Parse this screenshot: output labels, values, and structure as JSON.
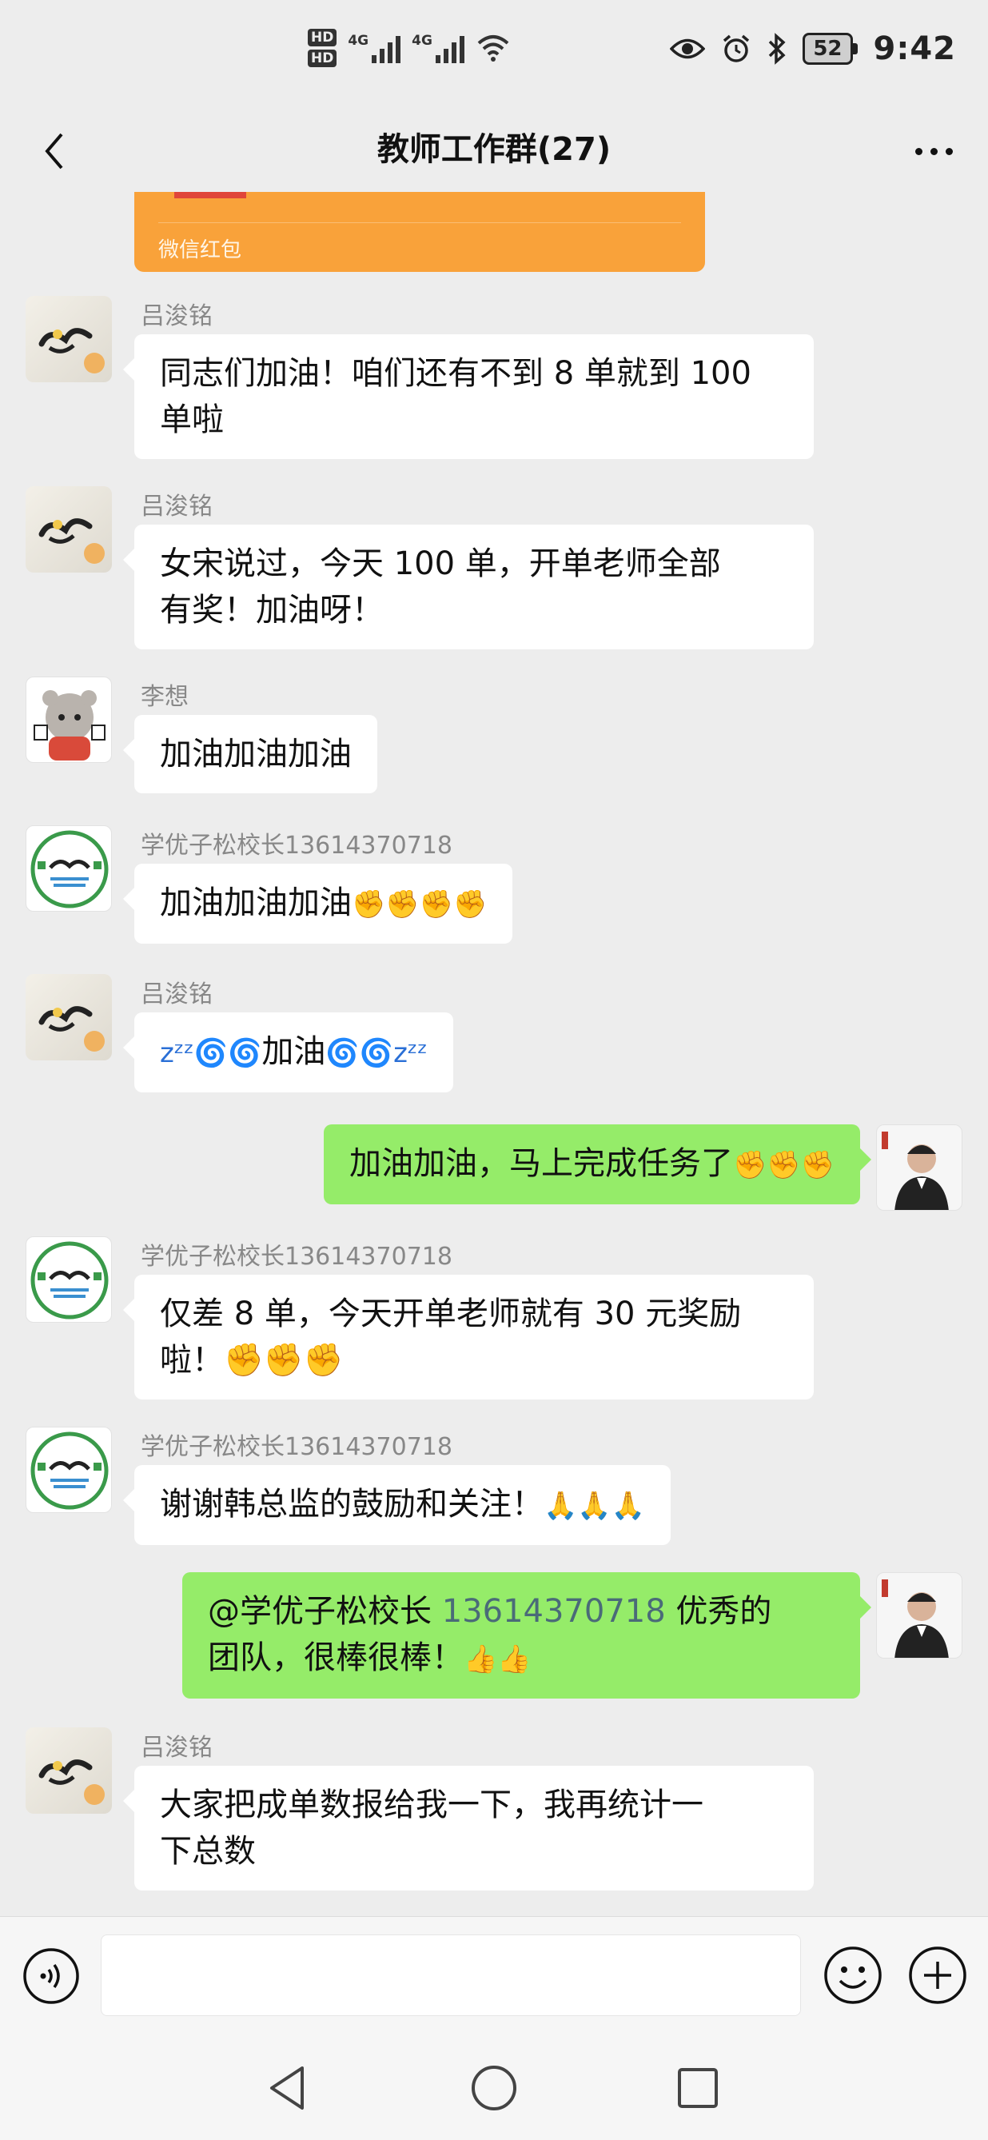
{
  "status_bar": {
    "hd1": "HD",
    "hd2": "HD",
    "net1": "4G",
    "net2": "4G",
    "battery": "52",
    "time": "9:42",
    "icons": [
      "eye-icon",
      "alarm-icon",
      "bluetooth-icon",
      "wifi-icon"
    ]
  },
  "nav": {
    "title": "教师工作群(27)"
  },
  "red_packet": {
    "label": "微信红包"
  },
  "messages": [
    {
      "side": "left",
      "sender": "吕浚铭",
      "lines": [
        "同志们加油！咱们还有不到 8 单就到 100",
        "单啦"
      ]
    },
    {
      "side": "left",
      "sender": "吕浚铭",
      "lines": [
        "女宋说过，今天 100 单，开单老师全部",
        "有奖！加油呀！"
      ]
    },
    {
      "side": "left",
      "sender": "李想",
      "lines": [
        "加油加油加油"
      ]
    },
    {
      "side": "left",
      "sender": "学优子松校长13614370718",
      "text": "加油加油加油",
      "emoji": "✊✊✊✊"
    },
    {
      "side": "left",
      "sender": "吕浚铭",
      "pre": "zᶻᶻ🌀🌀",
      "text": "加油",
      "post": "🌀🌀zᶻᶻ"
    },
    {
      "side": "right",
      "text": "加油加油，马上完成任务了",
      "emoji": "✊✊✊"
    },
    {
      "side": "left",
      "sender": "学优子松校长13614370718",
      "lines": [
        "仅差 8 单，今天开单老师就有 30 元奖励",
        "啦！✊✊✊"
      ]
    },
    {
      "side": "left",
      "sender": "学优子松校长13614370718",
      "text": "谢谢韩总监的鼓励和关注！",
      "emoji": "🙏🙏🙏"
    },
    {
      "side": "right",
      "mention": "@学优子松校长 ",
      "mention_num": "13614370718",
      "after": " 优秀的",
      "line2": "团队，很棒很棒！",
      "emoji": "👍👍"
    },
    {
      "side": "left",
      "sender": "吕浚铭",
      "lines": [
        "大家把成单数报给我一下，我再统计一",
        "下总数"
      ]
    }
  ],
  "colors": {
    "background": "#ededed",
    "self_bubble": "#95ec69",
    "other_bubble": "#ffffff",
    "red_packet": "#f9a23a",
    "sender_name": "#888888"
  }
}
